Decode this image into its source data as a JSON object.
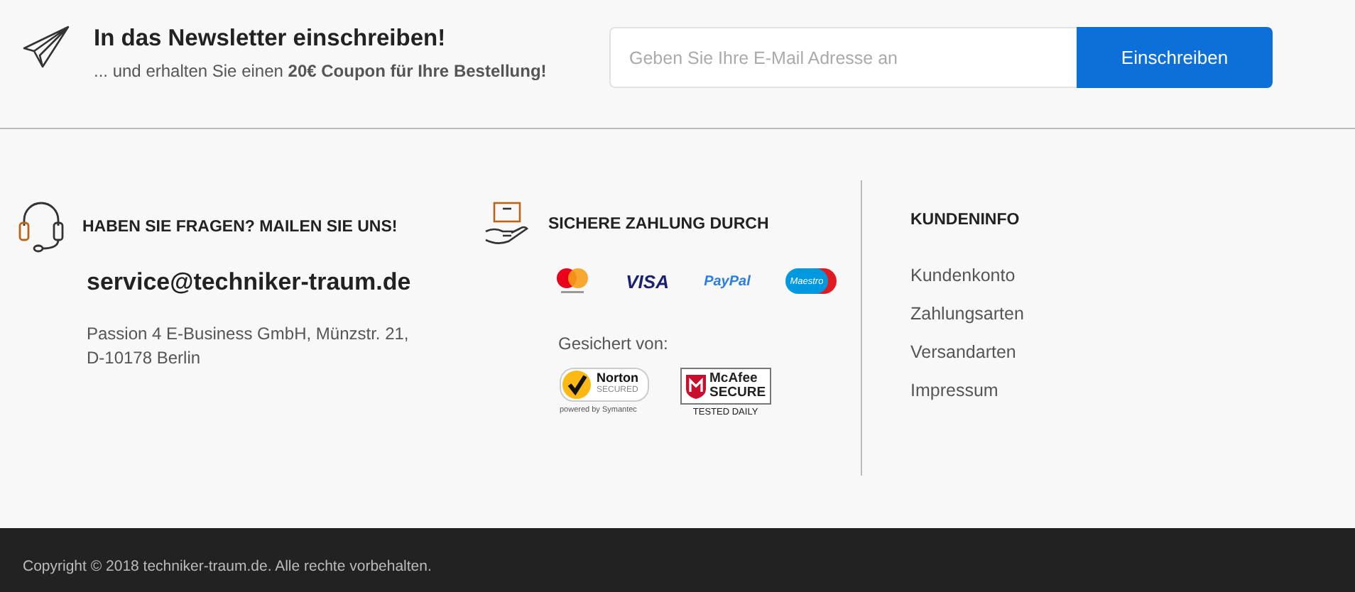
{
  "newsletter": {
    "title": "In das Newsletter einschreiben!",
    "subtitle": "... und erhalten Sie einen **20€ Coupon für Ihre Bestellung!**",
    "email_field": {
      "placeholder": "Geben Sie Ihre E-Mail Adresse an"
    },
    "button": "Einschreiben"
  },
  "contact": {
    "heading": "HABEN SIE FRAGEN? MAILEN SIE UNS!",
    "email": "service@techniker-traum.de",
    "address": [
      "Passion 4 E-Business GmbH, Münzstr. 21,",
      "D-10178 Berlin"
    ]
  },
  "payment": {
    "heading": "SICHERE ZAHLUNG DURCH",
    "logos": [
      {
        "kind": "mastercard"
      },
      {
        "kind": "visa",
        "text": "VISA"
      },
      {
        "kind": "paypal",
        "text": "PayPal"
      },
      {
        "kind": "maestro",
        "text": "Maestro"
      }
    ],
    "secured_label": "Gesichert von:",
    "seals": [
      {
        "kind": "norton",
        "name": "Norton",
        "sub": "SECURED",
        "footer": "powered by Symantec"
      },
      {
        "kind": "mcafee",
        "name": "McAfee",
        "sub": "SECURE",
        "footer": "TESTED DAILY"
      }
    ]
  },
  "customer_info": {
    "heading": "KUNDENINFO",
    "links": [
      "Kundenkonto",
      "Zahlungsarten",
      "Versandarten",
      "Impressum"
    ]
  },
  "copyright": "Copyright © 2018 techniker-traum.de. Alle rechte vorbehalten."
}
